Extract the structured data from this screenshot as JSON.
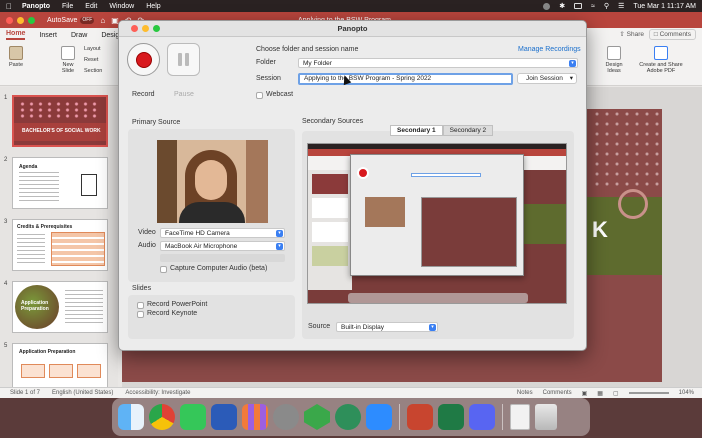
{
  "menubar": {
    "app_name": "Panopto",
    "items": [
      "File",
      "Edit",
      "Window",
      "Help"
    ],
    "clock": "Tue Mar 1  11:17 AM"
  },
  "ppt": {
    "autosave_label": "AutoSave",
    "autosave_state": "OFF",
    "document_title": "Applying to the BSW Program",
    "tabs": [
      "Home",
      "Insert",
      "Draw",
      "Design"
    ],
    "share_label": "Share",
    "comments_label": "Comments",
    "ribbon": {
      "paste": "Paste",
      "new_slide": "New Slide",
      "layout": "Layout",
      "reset": "Reset",
      "section": "Section",
      "design_ideas": "Design Ideas",
      "create_pdf": "Create and Share Adobe PDF"
    },
    "thumbnails": [
      {
        "num": "1",
        "title": "BACHELOR'S OF SOCIAL WORK"
      },
      {
        "num": "2",
        "title": "Agenda"
      },
      {
        "num": "3",
        "title": "Credits & Prerequisites"
      },
      {
        "num": "4",
        "title": "Application Preparation"
      },
      {
        "num": "5",
        "title": "Application Preparation"
      }
    ],
    "slide_letter": "K",
    "status": {
      "slide": "Slide 1 of 7",
      "language": "English (United States)",
      "accessibility": "Accessibility: Investigate",
      "notes": "Notes",
      "comments": "Comments",
      "zoom": "104%"
    }
  },
  "panopto": {
    "title": "Panopto",
    "record_label": "Record",
    "pause_label": "Pause",
    "choose_label": "Choose folder and session name",
    "manage_label": "Manage Recordings",
    "folder_label": "Folder",
    "folder_value": "My Folder",
    "session_label": "Session",
    "session_value": "Applying to the BSW Program - Spring 2022",
    "join_label": "Join Session",
    "webcast_label": "Webcast",
    "primary_source_label": "Primary Source",
    "video_label": "Video",
    "video_value": "FaceTime HD Camera",
    "audio_label": "Audio",
    "audio_value": "MacBook Air Microphone",
    "capture_audio_label": "Capture Computer Audio (beta)",
    "slides_label": "Slides",
    "record_ppt_label": "Record PowerPoint",
    "record_keynote_label": "Record Keynote",
    "secondary_sources_label": "Secondary Sources",
    "secondary_tabs": [
      "Secondary 1",
      "Secondary 2"
    ],
    "source_label": "Source",
    "source_value": "Built-in Display"
  },
  "colors": {
    "ppt_accent": "#b8453d",
    "record_red": "#d8191e",
    "link_blue": "#1a6fcc",
    "dropdown_blue": "#3a7ff2"
  }
}
